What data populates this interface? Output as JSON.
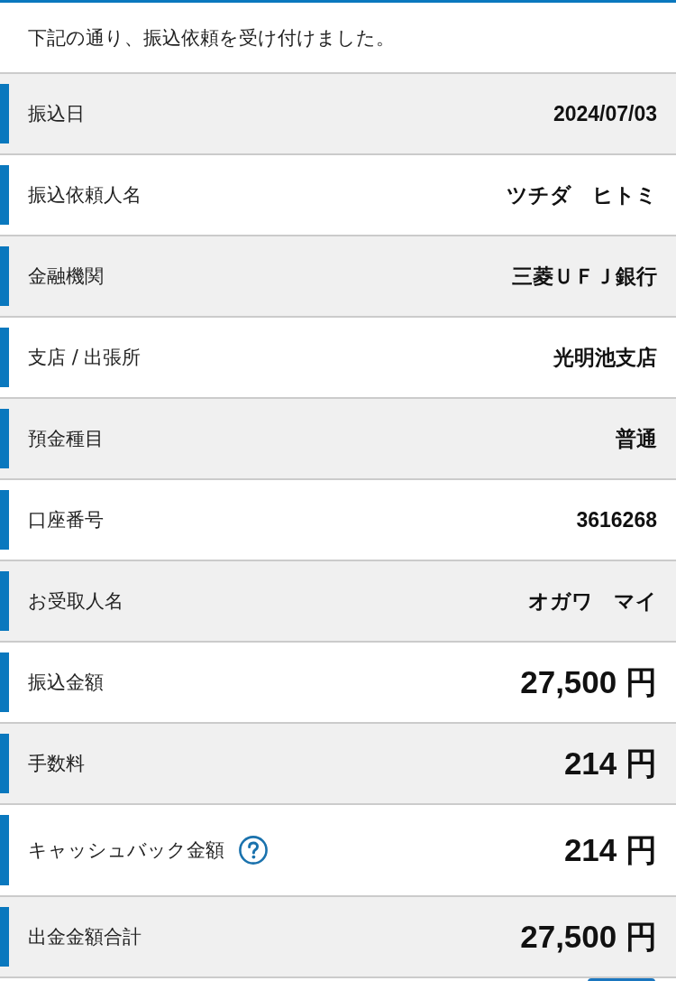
{
  "intro": "下記の通り、振込依頼を受け付けました。",
  "rows": [
    {
      "label": "振込日",
      "value": "2024/07/03",
      "kind": "text",
      "help": false
    },
    {
      "label": "振込依頼人名",
      "value": "ツチダ　ヒトミ",
      "kind": "text",
      "help": false
    },
    {
      "label": "金融機関",
      "value": "三菱ＵＦＪ銀行",
      "kind": "text",
      "help": false
    },
    {
      "label": "支店 / 出張所",
      "value": "光明池支店",
      "kind": "text",
      "help": false
    },
    {
      "label": "預金種目",
      "value": "普通",
      "kind": "text",
      "help": false
    },
    {
      "label": "口座番号",
      "value": "3616268",
      "kind": "text",
      "help": false
    },
    {
      "label": "お受取人名",
      "value": "オガワ　マイ",
      "kind": "text",
      "help": false
    },
    {
      "label": "振込金額",
      "value": "27,500 円",
      "kind": "amount",
      "help": false
    },
    {
      "label": "手数料",
      "value": "214 円",
      "kind": "amount",
      "help": false
    },
    {
      "label": "キャッシュバック金額",
      "value": "214 円",
      "kind": "amount",
      "help": true
    },
    {
      "label": "出金金額合計",
      "value": "27,500 円",
      "kind": "amount",
      "help": false
    }
  ]
}
